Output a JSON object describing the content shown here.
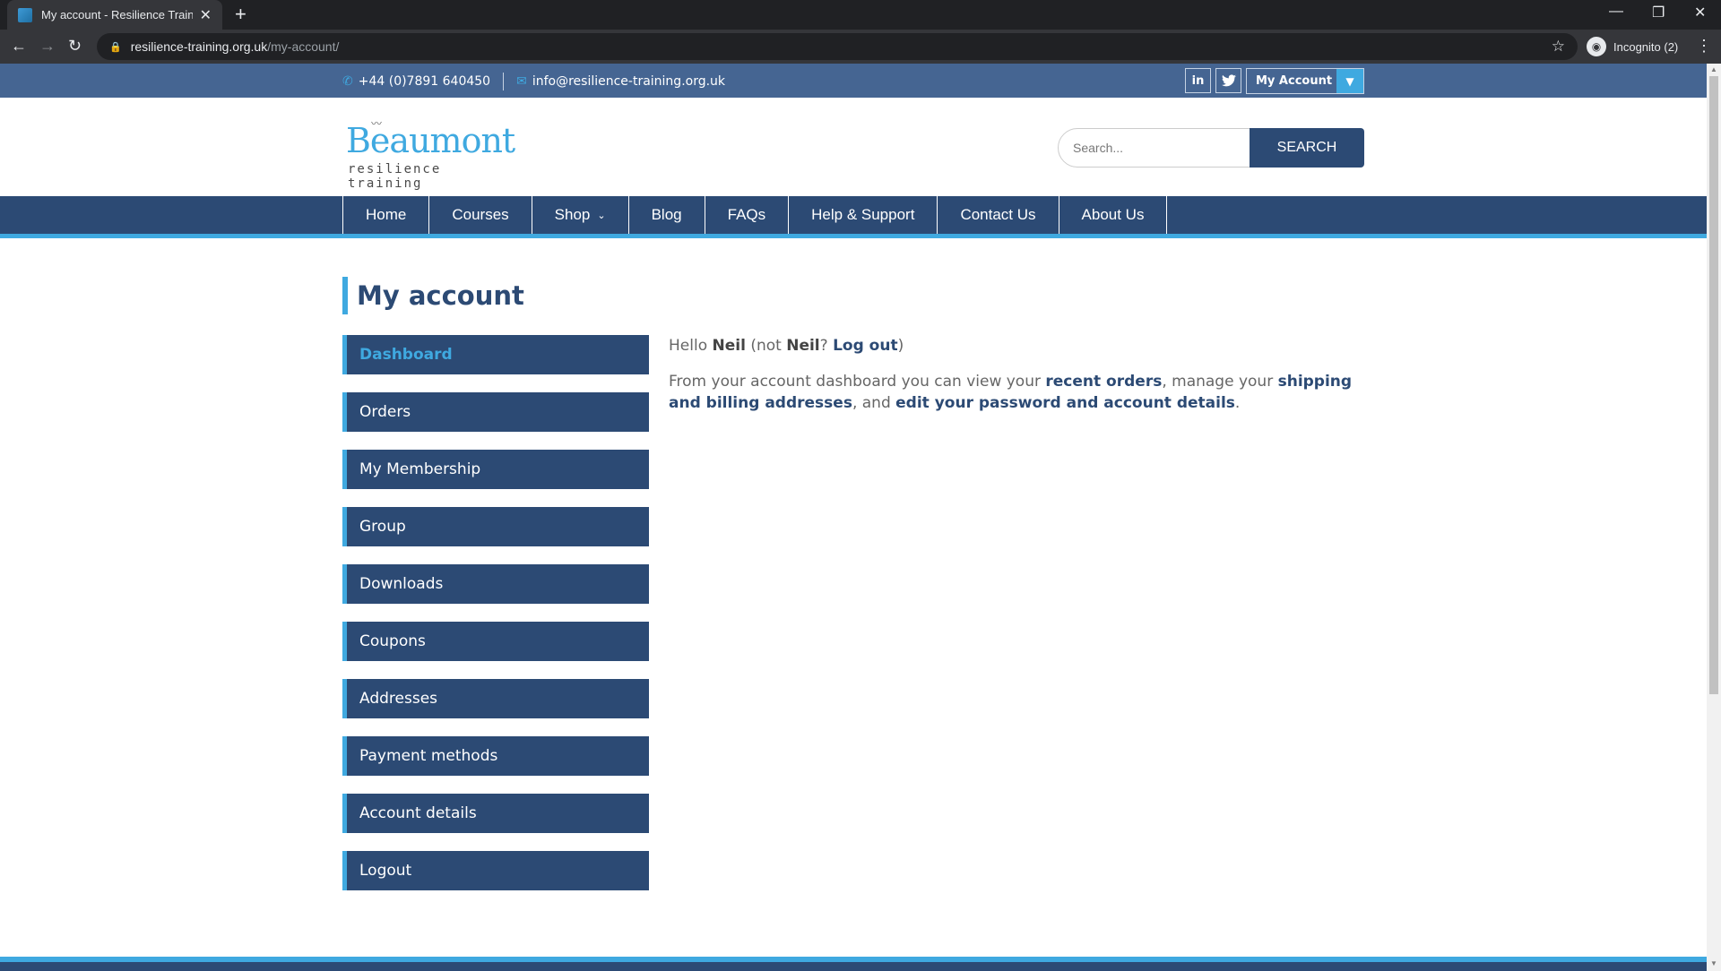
{
  "browser": {
    "tab_title": "My account - Resilience Training",
    "tab_close": "✕",
    "new_tab": "+",
    "url_domain": "resilience-training.org.uk",
    "url_path": "/my-account/",
    "incognito_label": "Incognito (2)"
  },
  "topbar": {
    "phone": "+44 (0)7891 640450",
    "email": "info@resilience-training.org.uk",
    "linkedin": "in",
    "account_label": "My Account"
  },
  "header": {
    "logo_name": "Beaumont",
    "logo_tagline": "resilience training",
    "search_placeholder": "Search...",
    "search_button": "SEARCH"
  },
  "nav": {
    "items": [
      "Home",
      "Courses",
      "Shop",
      "Blog",
      "FAQs",
      "Help & Support",
      "Contact Us",
      "About Us"
    ]
  },
  "main": {
    "title": "My account",
    "sidebar": [
      "Dashboard",
      "Orders",
      "My Membership",
      "Group",
      "Downloads",
      "Coupons",
      "Addresses",
      "Payment methods",
      "Account details",
      "Logout"
    ],
    "hello": "Hello",
    "user": "Neil",
    "not": "(not",
    "user2": "Neil",
    "q": "?",
    "logout": "Log out",
    "close_paren": ")",
    "dash_text_1": "From your account dashboard you can view your",
    "recent_orders": "recent orders",
    "dash_text_2": ", manage your",
    "shipping": "shipping and billing addresses",
    "dash_text_3": ", and",
    "edit": "edit your password and account details",
    "period": "."
  },
  "colors": {
    "topbar_bg": "#456592",
    "nav_bg": "#2c4a74",
    "accent": "#3fa9e0"
  }
}
